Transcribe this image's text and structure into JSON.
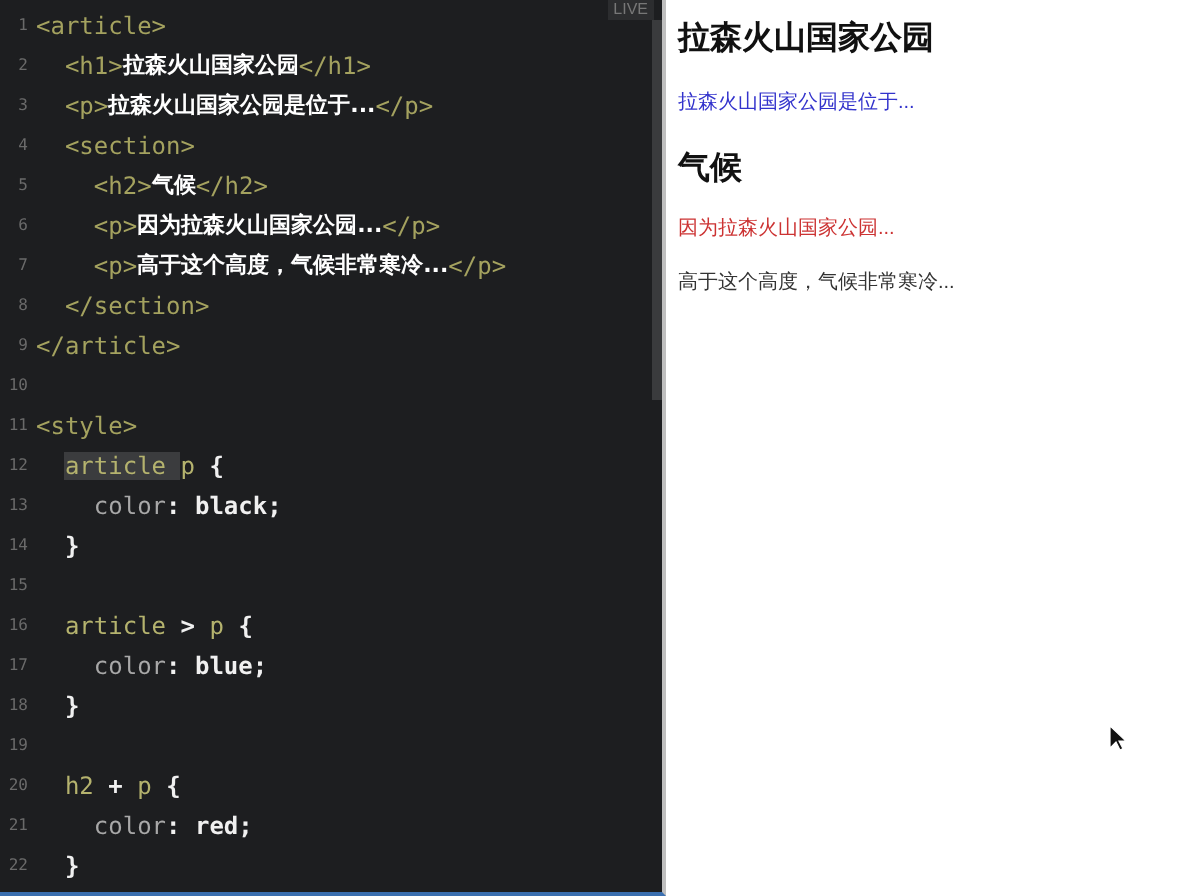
{
  "editor": {
    "badge": "LIVE",
    "lines": [
      {
        "number": "1",
        "tokens": [
          {
            "kind": "tag",
            "text": "<article>"
          }
        ]
      },
      {
        "number": "2",
        "tokens": [
          {
            "kind": "tag",
            "text": "  <h1>"
          },
          {
            "kind": "text",
            "text": "拉森火山国家公园"
          },
          {
            "kind": "tag",
            "text": "</h1>"
          }
        ]
      },
      {
        "number": "3",
        "tokens": [
          {
            "kind": "tag",
            "text": "  <p>"
          },
          {
            "kind": "text",
            "text": "拉森火山国家公园是位于..."
          },
          {
            "kind": "tag",
            "text": "</p>"
          }
        ]
      },
      {
        "number": "4",
        "tokens": [
          {
            "kind": "tag",
            "text": "  <section>"
          }
        ]
      },
      {
        "number": "5",
        "tokens": [
          {
            "kind": "tag",
            "text": "    <h2>"
          },
          {
            "kind": "text",
            "text": "气候"
          },
          {
            "kind": "tag",
            "text": "</h2>"
          }
        ]
      },
      {
        "number": "6",
        "tokens": [
          {
            "kind": "tag",
            "text": "    <p>"
          },
          {
            "kind": "text",
            "text": "因为拉森火山国家公园..."
          },
          {
            "kind": "tag",
            "text": "</p>"
          }
        ]
      },
      {
        "number": "7",
        "tokens": [
          {
            "kind": "tag",
            "text": "    <p>"
          },
          {
            "kind": "text",
            "text": "高于这个高度，气候非常寒冷..."
          },
          {
            "kind": "tag",
            "text": "</p>"
          }
        ]
      },
      {
        "number": "8",
        "tokens": [
          {
            "kind": "tag",
            "text": "  </section>"
          }
        ]
      },
      {
        "number": "9",
        "tokens": [
          {
            "kind": "tag",
            "text": "</article>"
          }
        ]
      },
      {
        "number": "10"
      },
      {
        "number": "11",
        "tokens": [
          {
            "kind": "tag",
            "text": "<style>"
          }
        ]
      },
      {
        "number": "12",
        "tokens": [
          {
            "kind": "selector",
            "text": "  article ",
            "selected": true
          },
          {
            "kind": "selector",
            "text": "p"
          },
          {
            "kind": "value",
            "text": " {"
          }
        ]
      },
      {
        "number": "13",
        "tokens": [
          {
            "kind": "prop",
            "text": "    color"
          },
          {
            "kind": "value",
            "text": ": black;"
          }
        ]
      },
      {
        "number": "14",
        "tokens": [
          {
            "kind": "value",
            "text": "  }"
          }
        ]
      },
      {
        "number": "15"
      },
      {
        "number": "16",
        "tokens": [
          {
            "kind": "selector",
            "text": "  article"
          },
          {
            "kind": "value",
            "text": " > "
          },
          {
            "kind": "selector",
            "text": "p"
          },
          {
            "kind": "value",
            "text": " {"
          }
        ]
      },
      {
        "number": "17",
        "tokens": [
          {
            "kind": "prop",
            "text": "    color"
          },
          {
            "kind": "value",
            "text": ": blue;"
          }
        ]
      },
      {
        "number": "18",
        "tokens": [
          {
            "kind": "value",
            "text": "  }"
          }
        ]
      },
      {
        "number": "19"
      },
      {
        "number": "20",
        "tokens": [
          {
            "kind": "selector",
            "text": "  h2"
          },
          {
            "kind": "value",
            "text": " + "
          },
          {
            "kind": "selector",
            "text": "p"
          },
          {
            "kind": "value",
            "text": " {"
          }
        ]
      },
      {
        "number": "21",
        "tokens": [
          {
            "kind": "prop",
            "text": "    color"
          },
          {
            "kind": "value",
            "text": ": red;"
          }
        ]
      },
      {
        "number": "22",
        "tokens": [
          {
            "kind": "value",
            "text": "  }"
          }
        ]
      }
    ]
  },
  "preview": {
    "blocks": [
      {
        "kind": "h1",
        "text": "拉森火山国家公园"
      },
      {
        "kind": "p",
        "text": "拉森火山国家公园是位于...",
        "color": "#3333cc"
      },
      {
        "kind": "h2",
        "text": "气候"
      },
      {
        "kind": "p",
        "text": "因为拉森火山国家公园...",
        "color": "#cc3333"
      },
      {
        "kind": "p",
        "text": "高于这个高度，气候非常寒冷...",
        "color": "#333333"
      }
    ]
  }
}
